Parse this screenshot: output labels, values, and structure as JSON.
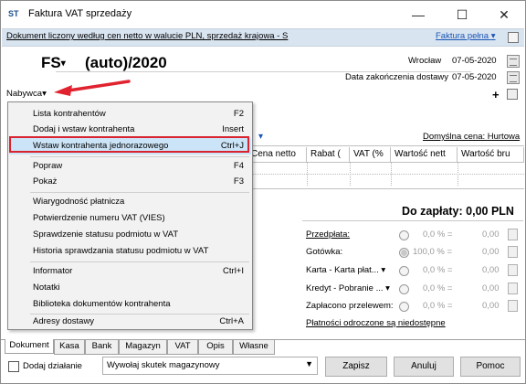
{
  "window": {
    "title": "Faktura VAT sprzedaży",
    "minimize": "—",
    "maximize": "☐",
    "close": "✕"
  },
  "infobar": {
    "text": "Dokument liczony według cen netto w walucie PLN, sprzedaż krajowa - S",
    "link": "Faktura pełna"
  },
  "doc": {
    "prefix": "FS",
    "number": "(auto)/2020",
    "place": "Wrocław",
    "date": "07-05-2020",
    "delivery_label": "Data zakończenia dostawy",
    "delivery_date": "07-05-2020",
    "buyer_label": "Nabywca",
    "default_price_label": "Domyślna cena: Hurtowa"
  },
  "grid": {
    "columns": [
      "Cena netto",
      "Rabat (",
      "VAT (%",
      "Wartość nett",
      "Wartość bru"
    ]
  },
  "menu": [
    {
      "label": "Lista kontrahentów",
      "shortcut": "F2"
    },
    {
      "label": "Dodaj i wstaw kontrahenta",
      "shortcut": "Insert"
    },
    {
      "label": "Wstaw kontrahenta jednorazowego",
      "shortcut": "Ctrl+J"
    },
    {
      "label": "Popraw",
      "shortcut": "F4"
    },
    {
      "label": "Pokaż",
      "shortcut": "F3"
    },
    {
      "label": "Wiarygodność płatnicza",
      "shortcut": ""
    },
    {
      "label": "Potwierdzenie numeru VAT (VIES)",
      "shortcut": ""
    },
    {
      "label": "Sprawdzenie statusu podmiotu w VAT",
      "shortcut": ""
    },
    {
      "label": "Historia sprawdzania statusu podmiotu w VAT",
      "shortcut": ""
    },
    {
      "label": "Informator",
      "shortcut": "Ctrl+I"
    },
    {
      "label": "Notatki",
      "shortcut": ""
    },
    {
      "label": "Biblioteka dokumentów kontrahenta",
      "shortcut": ""
    },
    {
      "label": "Adresy dostawy",
      "shortcut": "Ctrl+A"
    }
  ],
  "totals": {
    "label": "Do zapłaty: 0,00 PLN"
  },
  "payments": {
    "rows": [
      {
        "label": "Przedpłata:",
        "amount": "0,0 % =",
        "value": "0,00"
      },
      {
        "label": "Gotówka:",
        "amount": "100,0 % =",
        "value": "0,00"
      },
      {
        "label": "Karta - Karta płat...",
        "amount": "0,0 % =",
        "value": "0,00"
      },
      {
        "label": "Kredyt - Pobranie ...",
        "amount": "0,0 % =",
        "value": "0,00"
      },
      {
        "label": "Zapłacono przelewem:",
        "amount": "0,0 % =",
        "value": "0,00"
      }
    ],
    "deferred": "Płatności odroczone są niedostępne"
  },
  "tabs": [
    "Dokument",
    "Kasa",
    "Bank",
    "Magazyn",
    "VAT",
    "Opis",
    "Własne"
  ],
  "footer": {
    "checkbox_label": "Dodaj działanie",
    "select_value": "Wywołaj skutek magazynowy",
    "save": "Zapisz",
    "cancel": "Anuluj",
    "help": "Pomoc"
  }
}
